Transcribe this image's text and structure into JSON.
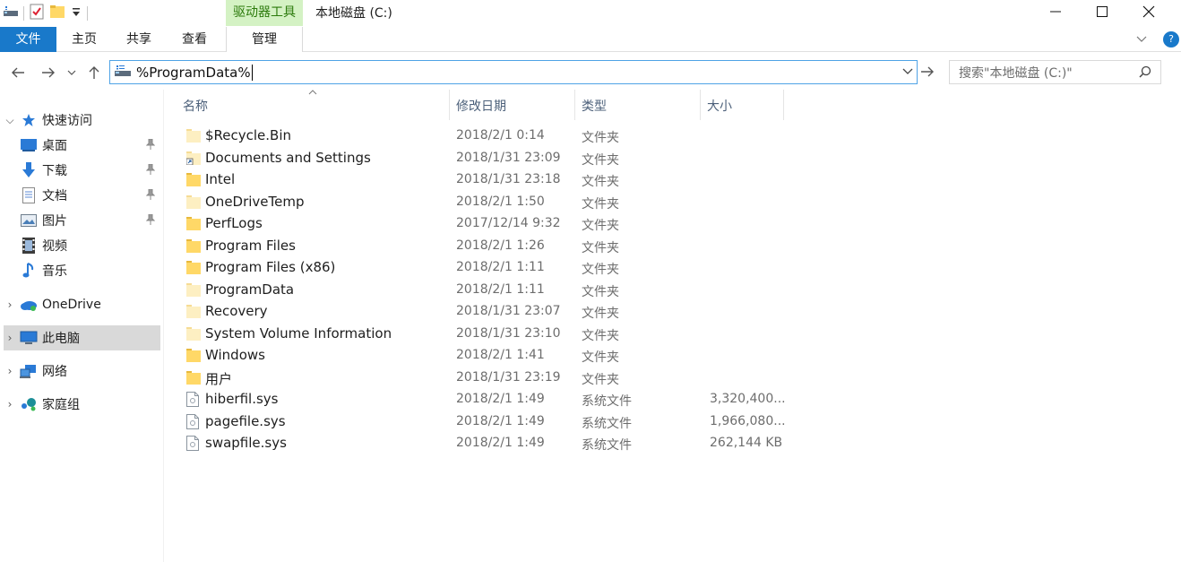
{
  "window": {
    "title": "本地磁盘 (C:)",
    "context_tab_header": "驱动器工具"
  },
  "ribbon": {
    "tabs": [
      {
        "label": "文件"
      },
      {
        "label": "主页"
      },
      {
        "label": "共享"
      },
      {
        "label": "查看"
      },
      {
        "label": "管理"
      }
    ],
    "help": "?"
  },
  "navbar": {
    "address_value": "%ProgramData%",
    "search_placeholder": "搜索\"本地磁盘 (C:)\""
  },
  "navpane": {
    "quick_access": "快速访问",
    "items": [
      {
        "label": "桌面",
        "icon": "desktop-icon"
      },
      {
        "label": "下载",
        "icon": "download-icon"
      },
      {
        "label": "文档",
        "icon": "document-icon"
      },
      {
        "label": "图片",
        "icon": "pictures-icon"
      },
      {
        "label": "视频",
        "icon": "video-icon"
      },
      {
        "label": "音乐",
        "icon": "music-icon"
      }
    ],
    "onedrive": "OneDrive",
    "this_pc": "此电脑",
    "network": "网络",
    "homegroup": "家庭组"
  },
  "columns": {
    "name": "名称",
    "date": "修改日期",
    "type": "类型",
    "size": "大小"
  },
  "files": [
    {
      "name": "$Recycle.Bin",
      "date": "2018/2/1 0:14",
      "type": "文件夹",
      "size": "",
      "icon": "folder-light"
    },
    {
      "name": "Documents and Settings",
      "date": "2018/1/31 23:09",
      "type": "文件夹",
      "size": "",
      "icon": "shortcut"
    },
    {
      "name": "Intel",
      "date": "2018/1/31 23:18",
      "type": "文件夹",
      "size": "",
      "icon": "folder"
    },
    {
      "name": "OneDriveTemp",
      "date": "2018/2/1 1:50",
      "type": "文件夹",
      "size": "",
      "icon": "folder-light"
    },
    {
      "name": "PerfLogs",
      "date": "2017/12/14 9:32",
      "type": "文件夹",
      "size": "",
      "icon": "folder"
    },
    {
      "name": "Program Files",
      "date": "2018/2/1 1:26",
      "type": "文件夹",
      "size": "",
      "icon": "folder"
    },
    {
      "name": "Program Files (x86)",
      "date": "2018/2/1 1:11",
      "type": "文件夹",
      "size": "",
      "icon": "folder"
    },
    {
      "name": "ProgramData",
      "date": "2018/2/1 1:11",
      "type": "文件夹",
      "size": "",
      "icon": "folder-light"
    },
    {
      "name": "Recovery",
      "date": "2018/1/31 23:07",
      "type": "文件夹",
      "size": "",
      "icon": "folder-light"
    },
    {
      "name": "System Volume Information",
      "date": "2018/1/31 23:10",
      "type": "文件夹",
      "size": "",
      "icon": "folder-light"
    },
    {
      "name": "Windows",
      "date": "2018/2/1 1:41",
      "type": "文件夹",
      "size": "",
      "icon": "folder"
    },
    {
      "name": "用户",
      "date": "2018/1/31 23:19",
      "type": "文件夹",
      "size": "",
      "icon": "folder"
    },
    {
      "name": "hiberfil.sys",
      "date": "2018/2/1 1:49",
      "type": "系统文件",
      "size": "3,320,400...",
      "icon": "sysfile"
    },
    {
      "name": "pagefile.sys",
      "date": "2018/2/1 1:49",
      "type": "系统文件",
      "size": "1,966,080...",
      "icon": "sysfile"
    },
    {
      "name": "swapfile.sys",
      "date": "2018/2/1 1:49",
      "type": "系统文件",
      "size": "262,144 KB",
      "icon": "sysfile"
    }
  ]
}
